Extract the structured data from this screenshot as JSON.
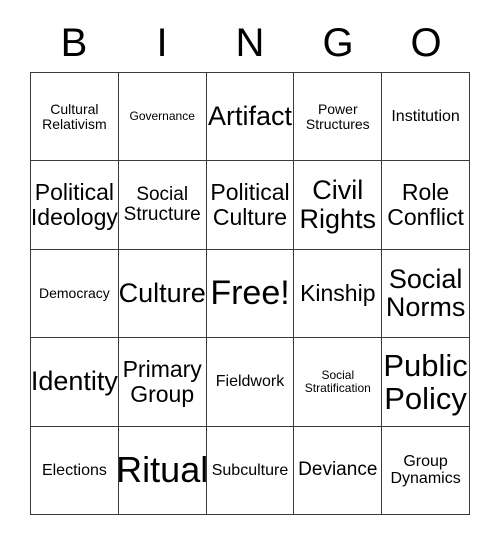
{
  "header": {
    "letters": [
      "B",
      "I",
      "N",
      "G",
      "O"
    ]
  },
  "card": {
    "rows": 5,
    "columns": 5,
    "border_color": "#3a3a3a",
    "background_color": "#ffffff",
    "text_color": "#000000",
    "cells": [
      {
        "text": "Cultural\nRelativism",
        "size": "sm"
      },
      {
        "text": "Governance",
        "size": "xs"
      },
      {
        "text": "Artifact",
        "size": "xxl"
      },
      {
        "text": "Power\nStructures",
        "size": "sm"
      },
      {
        "text": "Institution",
        "size": "md"
      },
      {
        "text": "Political\nIdeology",
        "size": "xl"
      },
      {
        "text": "Social\nStructure",
        "size": "lg"
      },
      {
        "text": "Political\nCulture",
        "size": "xl"
      },
      {
        "text": "Civil\nRights",
        "size": "xxl"
      },
      {
        "text": "Role\nConflict",
        "size": "xl"
      },
      {
        "text": "Democracy",
        "size": "sm"
      },
      {
        "text": "Culture",
        "size": "xxl"
      },
      {
        "text": "Free!",
        "size": "4xl"
      },
      {
        "text": "Kinship",
        "size": "xl"
      },
      {
        "text": "Social\nNorms",
        "size": "xxl"
      },
      {
        "text": "Identity",
        "size": "xxl"
      },
      {
        "text": "Primary\nGroup",
        "size": "xl"
      },
      {
        "text": "Fieldwork",
        "size": "md"
      },
      {
        "text": "Social\nStratification",
        "size": "xs"
      },
      {
        "text": "Public\nPolicy",
        "size": "3xl"
      },
      {
        "text": "Elections",
        "size": "md"
      },
      {
        "text": "Ritual",
        "size": "5xl"
      },
      {
        "text": "Subculture",
        "size": "md"
      },
      {
        "text": "Deviance",
        "size": "lg"
      },
      {
        "text": "Group\nDynamics",
        "size": "md"
      }
    ]
  }
}
